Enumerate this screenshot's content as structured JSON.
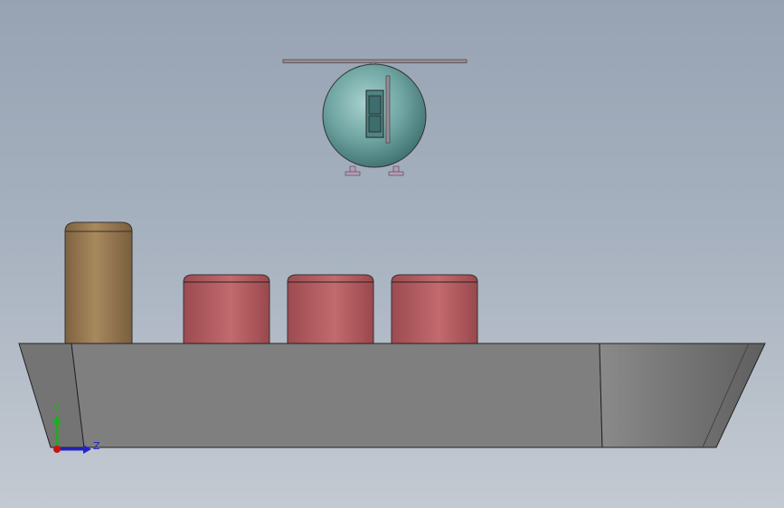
{
  "viewport": {
    "background_top": "#97a3b3",
    "background_bottom": "#c4cad2"
  },
  "model": {
    "hull_color": "#7f7f7f",
    "container_color": "#b5585c",
    "silo_color": "#9c7e55",
    "helicopter_body_color": "#6fa5a2",
    "rotor_color": "#9a8a94",
    "skid_color": "#b79ab8"
  },
  "triad": {
    "y_label": "Y",
    "z_label": "Z",
    "y_color": "#22aa22",
    "z_color": "#2222cc",
    "origin_color": "#cc1111"
  }
}
